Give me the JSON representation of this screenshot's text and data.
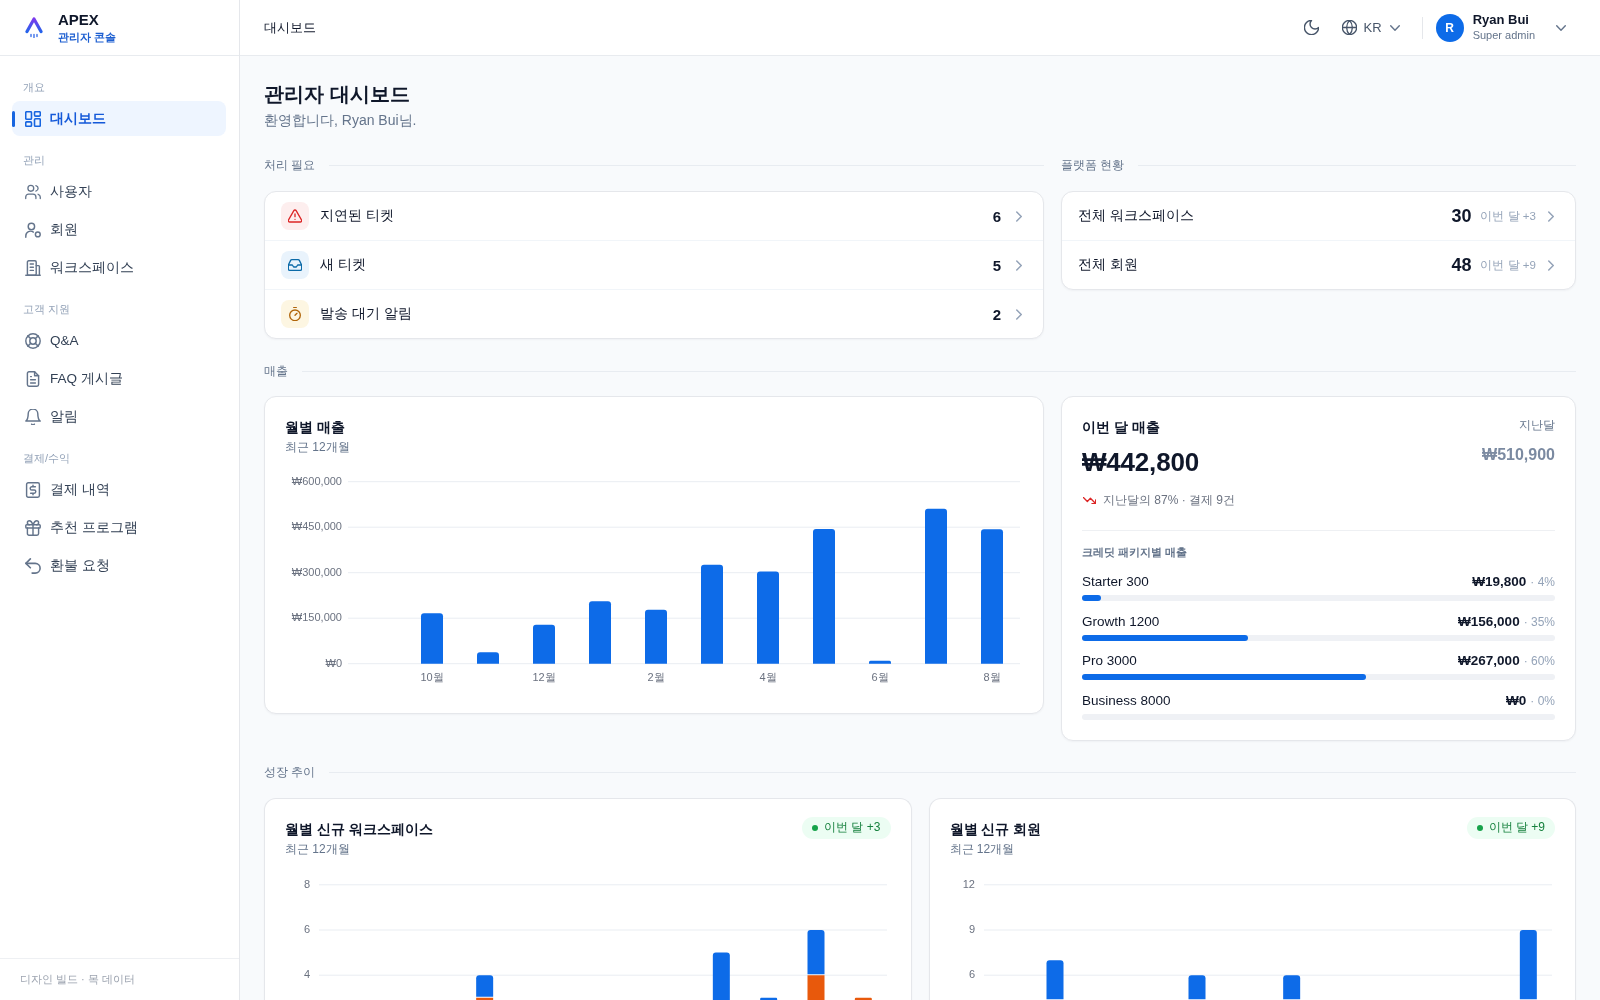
{
  "sidebar": {
    "brand": {
      "name": "APEX",
      "subtitle": "관리자 콘솔"
    },
    "sections": [
      {
        "label": "개요",
        "items": [
          {
            "kind": "dashboard",
            "label": "대시보드",
            "selected": true
          }
        ]
      },
      {
        "label": "관리",
        "items": [
          {
            "kind": "users",
            "label": "사용자",
            "selected": false
          },
          {
            "kind": "members",
            "label": "회원",
            "selected": false
          },
          {
            "kind": "workspaces",
            "label": "워크스페이스",
            "selected": false
          }
        ]
      },
      {
        "label": "고객 지원",
        "items": [
          {
            "kind": "qa",
            "label": "Q&A",
            "selected": false
          },
          {
            "kind": "faq",
            "label": "FAQ 게시글",
            "selected": false
          },
          {
            "kind": "notifications",
            "label": "알림",
            "selected": false
          }
        ]
      },
      {
        "label": "결제/수익",
        "items": [
          {
            "kind": "payments",
            "label": "결제 내역",
            "selected": false
          },
          {
            "kind": "referrals",
            "label": "추천 프로그램",
            "selected": false
          },
          {
            "kind": "refunds",
            "label": "환불 요청",
            "selected": false
          }
        ]
      }
    ],
    "footer": "디자인 빌드 · 목 데이터"
  },
  "header": {
    "title": "대시보드",
    "language": "KR",
    "user": {
      "initial": "R",
      "name": "Ryan Bui",
      "role": "Super admin"
    }
  },
  "page": {
    "title": "관리자 대시보드",
    "subtitle": "환영합니다, Ryan Bui님."
  },
  "action_required": {
    "label": "처리 필요",
    "items": [
      {
        "kind": "overdue",
        "label": "지연된 티켓",
        "count": "6"
      },
      {
        "kind": "new",
        "label": "새 티켓",
        "count": "5"
      },
      {
        "kind": "pending",
        "label": "발송 대기 알림",
        "count": "2"
      }
    ]
  },
  "platform": {
    "label": "플랫폼 현황",
    "items": [
      {
        "label": "전체 워크스페이스",
        "value": "30",
        "change": "이번 달 +3"
      },
      {
        "label": "전체 회원",
        "value": "48",
        "change": "이번 달 +9"
      }
    ]
  },
  "revenue": {
    "label": "매출",
    "monthly": {
      "title": "월별 매출",
      "subtitle": "최근 12개월",
      "chart_data": {
        "type": "bar",
        "categories": [
          null,
          "10월",
          null,
          "12월",
          null,
          "2월",
          null,
          "4월",
          null,
          "6월",
          null,
          "8월"
        ],
        "series": [
          {
            "color": "#0d6be8",
            "values": [
              0,
              166000,
              38000,
              128000,
              206000,
              178000,
              326000,
              304000,
              444000,
              10000,
              511000,
              443000
            ]
          }
        ],
        "ylim": [
          0,
          600000
        ],
        "yticks": [
          {
            "value": 0,
            "label": "₩0"
          },
          {
            "value": 150000,
            "label": "₩150,000"
          },
          {
            "value": 300000,
            "label": "₩300,000"
          },
          {
            "value": 450000,
            "label": "₩450,000"
          },
          {
            "value": 600000,
            "label": "₩600,000"
          }
        ],
        "grid": true
      }
    },
    "this_month": {
      "title": "이번 달 매출",
      "amount": "₩442,800",
      "previous_label": "지난달",
      "previous_amount": "₩510,900",
      "trend": {
        "decrease": true,
        "text": "지난달의 87% · 결제 9건"
      },
      "packages_title": "크레딧 패키지별 매출",
      "packages": [
        {
          "name": "Starter 300",
          "amount": "₩19,800",
          "share": "· 4%",
          "level": 0.04
        },
        {
          "name": "Growth 1200",
          "amount": "₩156,000",
          "share": "· 35%",
          "level": 0.35
        },
        {
          "name": "Pro 3000",
          "amount": "₩267,000",
          "share": "· 60%",
          "level": 0.6
        },
        {
          "name": "Business 8000",
          "amount": "₩0",
          "share": "· 0%"
        }
      ]
    }
  },
  "growth": {
    "label": "성장 추이",
    "charts": [
      {
        "title": "월별 신규 워크스페이스",
        "subtitle": "최근 12개월",
        "badge": "이번 달 +3",
        "y_labels": [
          "8",
          "6",
          "4"
        ]
      },
      {
        "title": "월별 신규 회원",
        "subtitle": "최근 12개월",
        "badge": "이번 달 +9",
        "y_labels": [
          "12",
          "9",
          "6"
        ]
      }
    ]
  }
}
